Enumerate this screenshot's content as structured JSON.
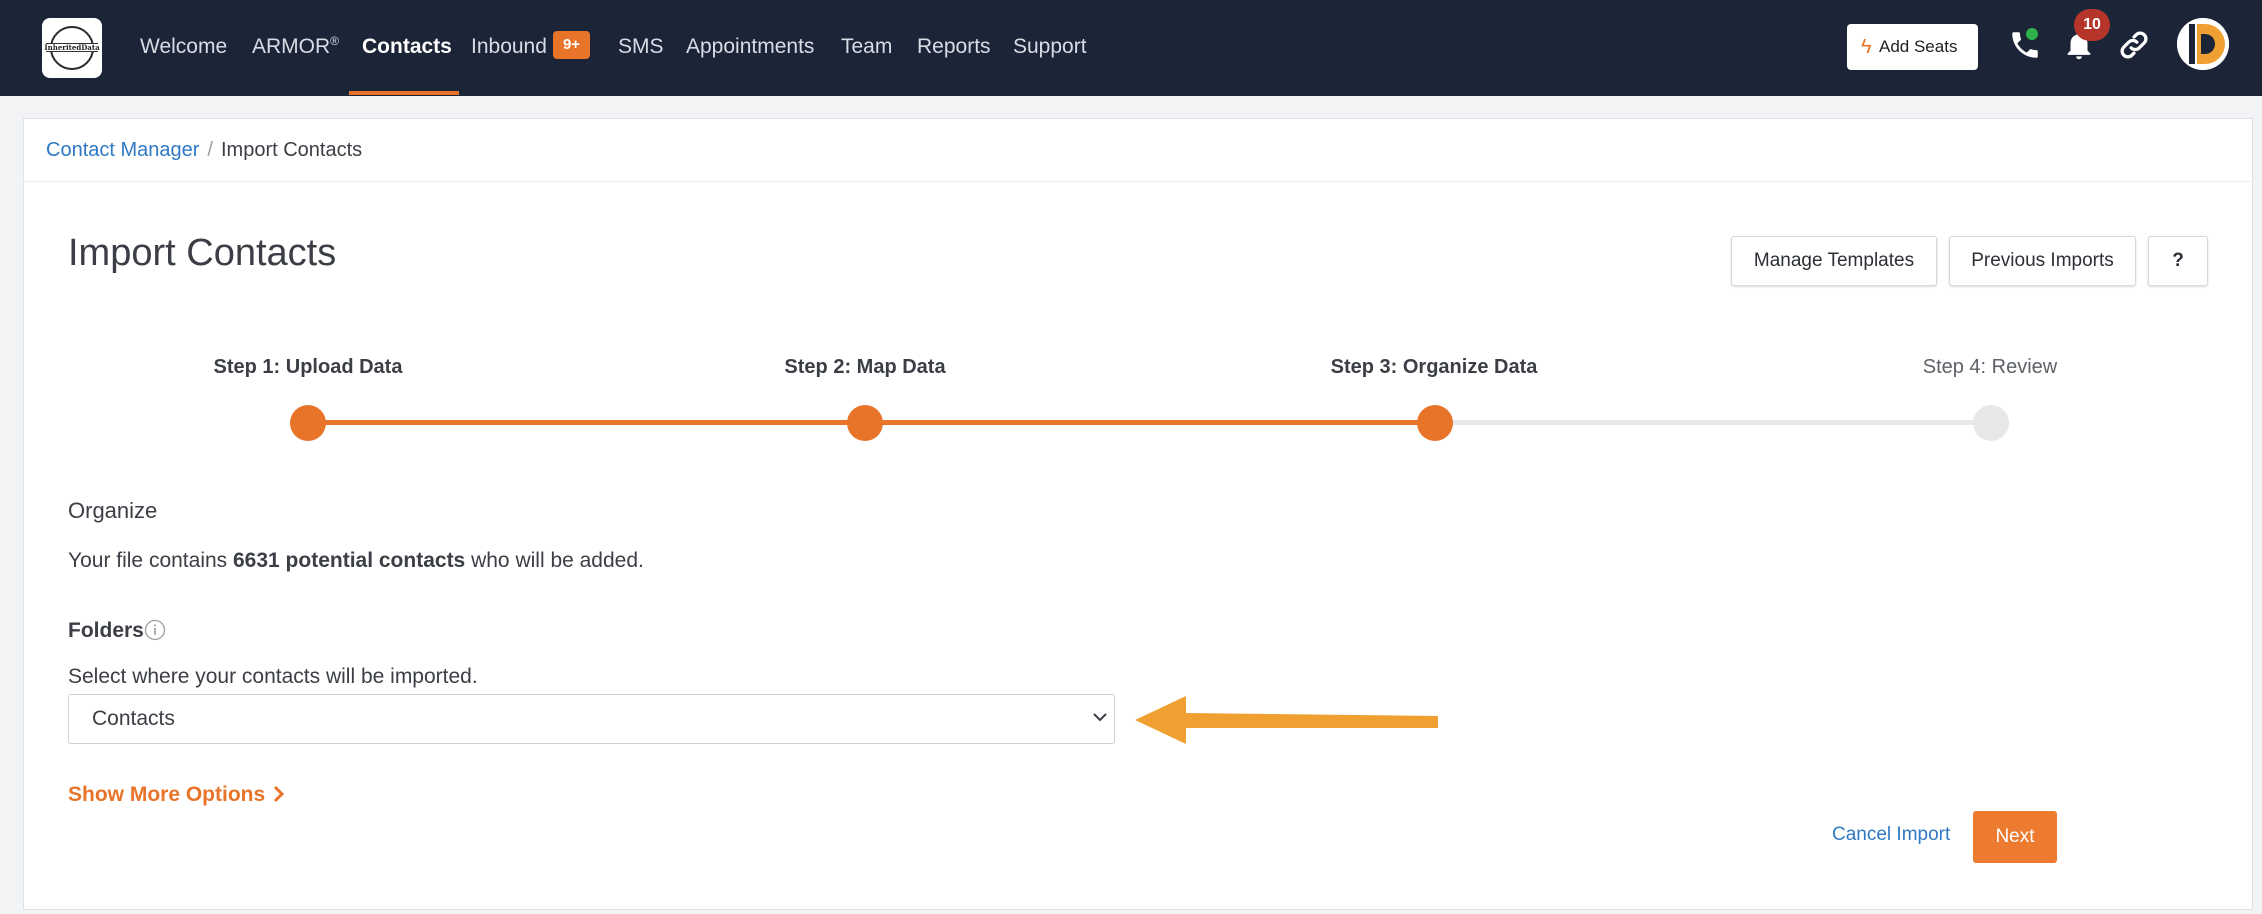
{
  "brand": {
    "logo_text": "InheritedData"
  },
  "nav": {
    "items": [
      {
        "label": "Welcome"
      },
      {
        "label": "ARMOR",
        "suffix": "®"
      },
      {
        "label": "Contacts"
      },
      {
        "label": "Inbound",
        "badge": "9+"
      },
      {
        "label": "SMS"
      },
      {
        "label": "Appointments"
      },
      {
        "label": "Team"
      },
      {
        "label": "Reports"
      },
      {
        "label": "Support"
      }
    ],
    "active": "Contacts"
  },
  "topbar": {
    "add_seats_label": "Add Seats",
    "notifications_count": "10",
    "icons": [
      "lightning-icon",
      "phone-icon",
      "bell-icon",
      "link-icon",
      "avatar"
    ]
  },
  "breadcrumb": {
    "parent": "Contact Manager",
    "separator": "/",
    "current": "Import Contacts"
  },
  "page": {
    "title": "Import Contacts",
    "buttons": {
      "manage_templates": "Manage Templates",
      "previous_imports": "Previous Imports",
      "help": "?"
    }
  },
  "stepper": {
    "steps": [
      {
        "label": "Step 1: Upload Data",
        "status": "complete"
      },
      {
        "label": "Step 2: Map Data",
        "status": "complete"
      },
      {
        "label": "Step 3: Organize Data",
        "status": "current"
      },
      {
        "label": "Step 4: Review",
        "status": "pending"
      }
    ]
  },
  "organize": {
    "title": "Organize",
    "file_text_prefix": "Your file contains ",
    "file_text_count": "6631 potential contacts",
    "file_text_suffix": " who will be added.",
    "folders_label": "Folders",
    "select_hint": "Select where your contacts will be imported.",
    "selected_folder": "Contacts",
    "show_more_label": "Show More Options"
  },
  "actions": {
    "cancel_label": "Cancel Import",
    "next_label": "Next"
  },
  "colors": {
    "accent": "#e8742a",
    "nav_bg": "#1c2538",
    "link": "#2f79c4",
    "annotation_arrow": "#f0a030"
  }
}
